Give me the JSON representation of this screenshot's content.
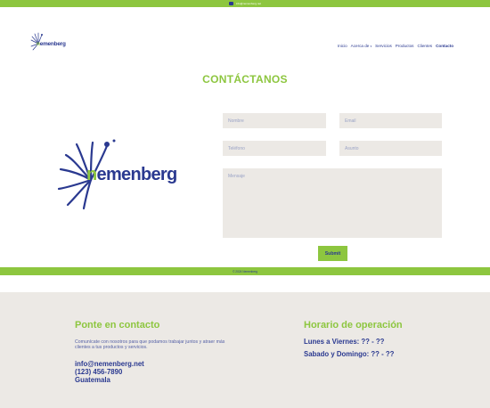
{
  "topbar": {
    "email": "info@nemenberg.net",
    "icon": "mail-icon",
    "color": "#8dc63f"
  },
  "header": {
    "logo": {
      "first": "n",
      "rest": "emenberg"
    },
    "nav": [
      {
        "label": "Inicio"
      },
      {
        "label": "Acerca de"
      },
      {
        "label": "Servicios"
      },
      {
        "label": "Productos"
      },
      {
        "label": "Clientes"
      },
      {
        "label": "Contacto",
        "active": true
      }
    ]
  },
  "contact": {
    "title": "CONTÁCTANOS",
    "logo": {
      "first": "n",
      "rest": "emenberg"
    },
    "form": {
      "nombre_placeholder": "Nombre",
      "email_placeholder": "Email",
      "telefono_placeholder": "Teléfono",
      "asunto_placeholder": "Asunto",
      "mensaje_placeholder": "Mensaje",
      "submit_label": "Submit"
    }
  },
  "copyright": "© 2024 Nemenberg",
  "footer": {
    "contact_title": "Ponte en contacto",
    "contact_desc": "Comunícate con nosotros para que podamos trabajar juntos y atraer más clientes a tus productos y servicios.",
    "email": "info@nemenberg.net",
    "phone": "(123) 456-7890",
    "location": "Guatemala",
    "hours_title": "Horario de operación",
    "weekday_hours": "Lunes a Viernes: ?? - ??",
    "weekend_hours": "Sabado y Domingo: ?? - ??"
  },
  "colors": {
    "accent_green": "#8dc63f",
    "brand_blue": "#2a3990",
    "field_bg": "#ece9e5"
  }
}
